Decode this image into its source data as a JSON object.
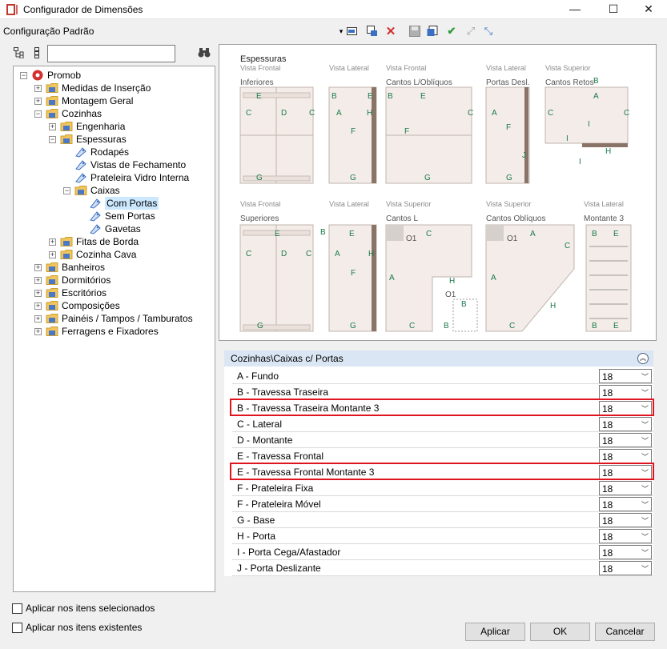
{
  "window": {
    "title": "Configurador de Dimensões",
    "minimize": "—",
    "maximize": "☐",
    "close": "✕"
  },
  "toolbar": {
    "config_label": "Configuração Padrão",
    "dropdown_arrow": "▾"
  },
  "tree": {
    "items": [
      {
        "label": "Promob",
        "level": 0,
        "expander": "−",
        "icon": "promob-logo-icon"
      },
      {
        "label": "Medidas de Inserção",
        "level": 1,
        "expander": "+",
        "icon": "folder-icon"
      },
      {
        "label": "Montagem Geral",
        "level": 1,
        "expander": "+",
        "icon": "folder-icon"
      },
      {
        "label": "Cozinhas",
        "level": 1,
        "expander": "−",
        "icon": "folder-icon"
      },
      {
        "label": "Engenharia",
        "level": 2,
        "expander": "+",
        "icon": "folder-icon"
      },
      {
        "label": "Espessuras",
        "level": 2,
        "expander": "−",
        "icon": "folder-icon"
      },
      {
        "label": "Rodapés",
        "level": 3,
        "expander": "",
        "icon": "tag-icon"
      },
      {
        "label": "Vistas de Fechamento",
        "level": 3,
        "expander": "",
        "icon": "tag-icon"
      },
      {
        "label": "Prateleira Vidro Interna",
        "level": 3,
        "expander": "",
        "icon": "tag-icon"
      },
      {
        "label": "Caixas",
        "level": 3,
        "expander": "−",
        "icon": "folder-icon"
      },
      {
        "label": "Com Portas",
        "level": 4,
        "expander": "",
        "icon": "tag-icon",
        "selected": true
      },
      {
        "label": "Sem Portas",
        "level": 4,
        "expander": "",
        "icon": "tag-icon"
      },
      {
        "label": "Gavetas",
        "level": 4,
        "expander": "",
        "icon": "tag-icon"
      },
      {
        "label": "Fitas de Borda",
        "level": 2,
        "expander": "+",
        "icon": "folder-icon"
      },
      {
        "label": "Cozinha Cava",
        "level": 2,
        "expander": "+",
        "icon": "folder-icon"
      },
      {
        "label": "Banheiros",
        "level": 1,
        "expander": "+",
        "icon": "folder-icon"
      },
      {
        "label": "Dormitórios",
        "level": 1,
        "expander": "+",
        "icon": "folder-icon"
      },
      {
        "label": "Escritórios",
        "level": 1,
        "expander": "+",
        "icon": "folder-icon"
      },
      {
        "label": "Composições",
        "level": 1,
        "expander": "+",
        "icon": "folder-icon"
      },
      {
        "label": "Painéis / Tampos / Tamburatos",
        "level": 1,
        "expander": "+",
        "icon": "folder-icon"
      },
      {
        "label": "Ferragens e Fixadores",
        "level": 1,
        "expander": "+",
        "icon": "folder-icon"
      }
    ]
  },
  "preview": {
    "heading": "Espessuras",
    "top_labels": [
      {
        "view": "Vista Frontal",
        "name": "Inferiores"
      },
      {
        "view": "Vista Lateral",
        "name": ""
      },
      {
        "view": "Vista Frontal",
        "name": "Cantos L/Oblíquos"
      },
      {
        "view": "Vista Lateral",
        "name": "Portas Desl."
      },
      {
        "view": "Vista Superior",
        "name": "Cantos Retos"
      }
    ],
    "bottom_labels": [
      {
        "view": "Vista Frontal",
        "name": "Superiores"
      },
      {
        "view": "Vista Lateral",
        "name": ""
      },
      {
        "view": "Vista Superior",
        "name": "Cantos L"
      },
      {
        "view": "Vista Superior",
        "name": "Cantos Oblíquos"
      },
      {
        "view": "Vista Lateral",
        "name": "Montante 3"
      }
    ],
    "corner_label": "O1"
  },
  "properties": {
    "path": "Cozinhas\\Caixas c/ Portas",
    "collapse_icon": "︽",
    "rows": [
      {
        "name": "A - Fundo",
        "value": "18"
      },
      {
        "name": "B - Travessa Traseira",
        "value": "18"
      },
      {
        "name": "B - Travessa Traseira Montante 3",
        "value": "18",
        "highlight": true
      },
      {
        "name": "C - Lateral",
        "value": "18"
      },
      {
        "name": "D - Montante",
        "value": "18"
      },
      {
        "name": "E - Travessa Frontal",
        "value": "18"
      },
      {
        "name": "E - Travessa Frontal Montante 3",
        "value": "18",
        "highlight": true
      },
      {
        "name": "F - Prateleira Fixa",
        "value": "18"
      },
      {
        "name": "F - Prateleira Móvel",
        "value": "18"
      },
      {
        "name": "G - Base",
        "value": "18"
      },
      {
        "name": "H - Porta",
        "value": "18"
      },
      {
        "name": "I - Porta Cega/Afastador",
        "value": "18"
      },
      {
        "name": "J - Porta Deslizante",
        "value": "18"
      }
    ]
  },
  "options": {
    "apply_selected": "Aplicar nos itens selecionados",
    "apply_existing": "Aplicar nos itens existentes"
  },
  "buttons": {
    "apply": "Aplicar",
    "ok": "OK",
    "cancel": "Cancelar"
  },
  "colors": {
    "highlight": "#e0141e",
    "marker": "#1a7a4a",
    "panel_fill": "#f4ece8",
    "header_band": "#dbe6f4"
  }
}
